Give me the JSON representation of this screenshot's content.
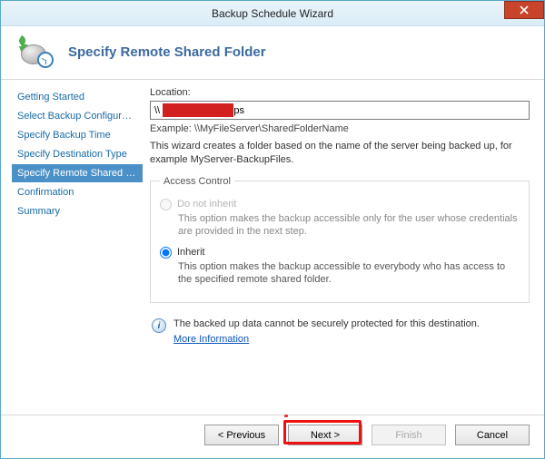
{
  "window": {
    "title": "Backup Schedule Wizard"
  },
  "header": {
    "title": "Specify Remote Shared Folder"
  },
  "sidebar": {
    "steps": [
      "Getting Started",
      "Select Backup Configurat...",
      "Specify Backup Time",
      "Specify Destination Type",
      "Specify Remote Shared F...",
      "Confirmation",
      "Summary"
    ],
    "active_index": 4
  },
  "content": {
    "location_label": "Location:",
    "location_value": "\\\\                \\backups",
    "example": "Example: \\\\MyFileServer\\SharedFolderName",
    "description": "This wizard creates a folder based on the name of the server being backed up, for example MyServer-BackupFiles.",
    "access_control": {
      "legend": "Access Control",
      "do_not_inherit": {
        "label": "Do not inherit",
        "sub": "This option makes the backup accessible only for the user whose credentials are provided in the next step.",
        "enabled": false,
        "checked": false
      },
      "inherit": {
        "label": "Inherit",
        "sub": "This option makes the backup accessible to everybody who has access to the specified remote shared folder.",
        "enabled": true,
        "checked": true
      }
    },
    "info": {
      "text": "The backed up data cannot be securely protected for this destination.",
      "link": "More Information"
    }
  },
  "footer": {
    "previous": "< Previous",
    "next": "Next >",
    "finish": "Finish",
    "cancel": "Cancel"
  }
}
